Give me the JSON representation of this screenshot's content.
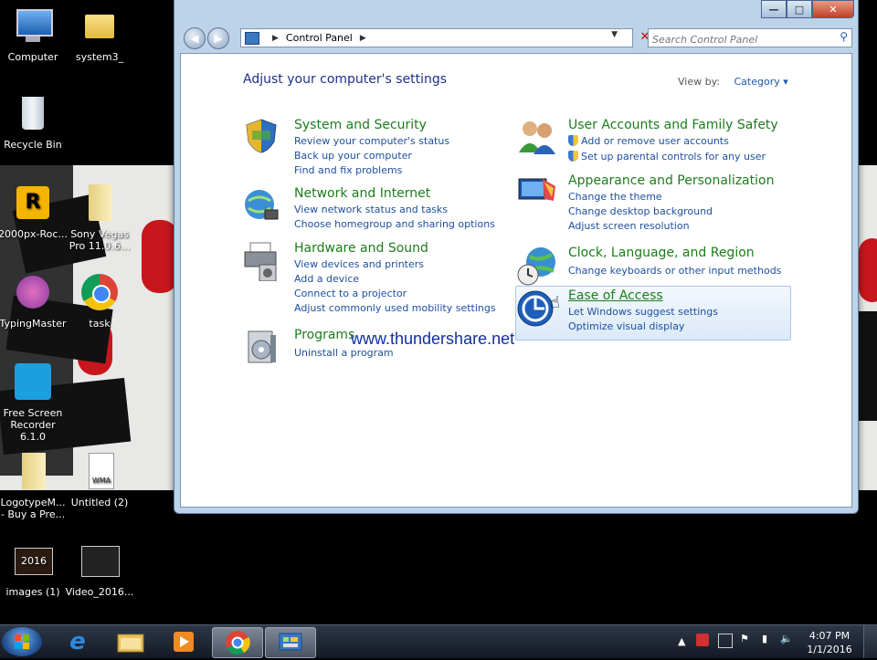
{
  "desktop": {
    "icons": [
      {
        "label": "Computer"
      },
      {
        "label": "system3_"
      },
      {
        "label": "Recycle Bin"
      },
      {
        "label": "2000px-Roc..."
      },
      {
        "label": "Sony Vegas Pro 11.0.6..."
      },
      {
        "label": "TypingMaster"
      },
      {
        "label": "task"
      },
      {
        "label": "Free Screen Recorder 6.1.0"
      },
      {
        "label": "LogotypeM... - Buy a Pre..."
      },
      {
        "label": "Untitled (2)"
      },
      {
        "label": "images (1)"
      },
      {
        "label": "Video_2016..."
      }
    ]
  },
  "window": {
    "title_buttons": {
      "minimize": "—",
      "maximize": "□",
      "close": "✕"
    },
    "address": {
      "crumb": "Control Panel"
    },
    "search": {
      "placeholder": "Search Control Panel"
    },
    "heading": "Adjust your computer's settings",
    "view_by": {
      "label": "View by:",
      "value": "Category ▾"
    },
    "categories_left": [
      {
        "title": "System and Security",
        "icon": "shield-icon",
        "links": [
          "Review your computer's status",
          "Back up your computer",
          "Find and fix problems"
        ]
      },
      {
        "title": "Network and Internet",
        "icon": "globe-network-icon",
        "links": [
          "View network status and tasks",
          "Choose homegroup and sharing options"
        ]
      },
      {
        "title": "Hardware and Sound",
        "icon": "printer-icon",
        "links": [
          "View devices and printers",
          "Add a device",
          "Connect to a projector",
          "Adjust commonly used mobility settings"
        ]
      },
      {
        "title": "Programs",
        "icon": "programs-icon",
        "links": [
          "Uninstall a program"
        ]
      }
    ],
    "categories_right": [
      {
        "title": "User Accounts and Family Safety",
        "icon": "users-icon",
        "links": [
          "Add or remove user accounts",
          "Set up parental controls for any user"
        ]
      },
      {
        "title": "Appearance and Personalization",
        "icon": "display-icon",
        "links": [
          "Change the theme",
          "Change desktop background",
          "Adjust screen resolution"
        ]
      },
      {
        "title": "Clock, Language, and Region",
        "icon": "clock-globe-icon",
        "links": [
          "Change keyboards or other input methods"
        ]
      },
      {
        "title": "Ease of Access",
        "icon": "ease-of-access-icon",
        "links": [
          "Let Windows suggest settings",
          "Optimize visual display"
        ]
      }
    ],
    "watermark": "www.thundershare.net"
  },
  "taskbar": {
    "items": [
      "start-orb",
      "internet-explorer",
      "file-explorer",
      "media-player",
      "chrome",
      "control-panel"
    ],
    "clock": {
      "time": "4:07 PM",
      "date": "1/1/2016"
    }
  },
  "colors": {
    "link": "#1e4fa0",
    "category_title": "#1c7d1c",
    "heading": "#1e3287"
  }
}
